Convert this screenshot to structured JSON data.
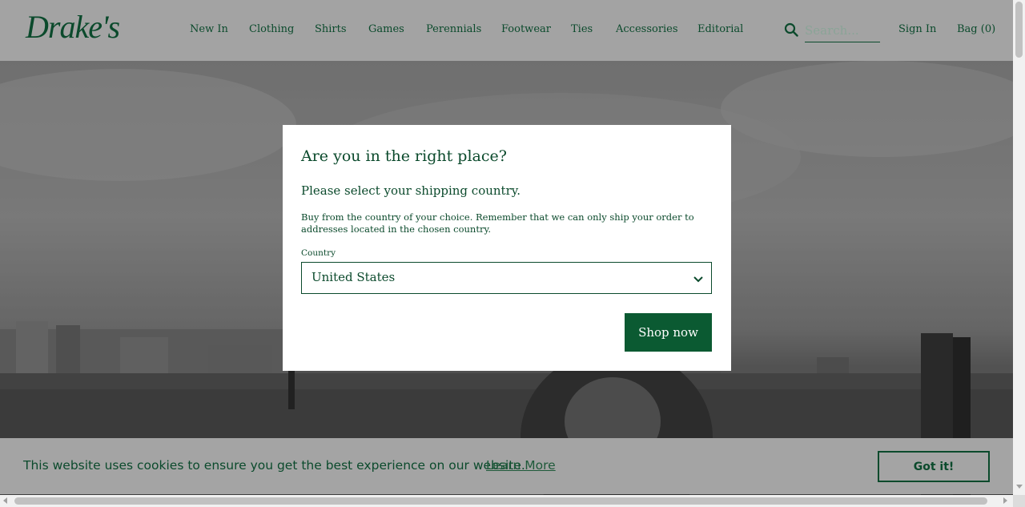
{
  "header": {
    "logo": "Drake's",
    "nav": [
      "New In",
      "Clothing",
      "Shirts",
      "Games",
      "Perennials",
      "Footwear",
      "Ties",
      "Accessories",
      "Editorial"
    ],
    "search_placeholder": "Search...",
    "sign_in": "Sign In",
    "bag": "Bag  (0)"
  },
  "modal": {
    "title": "Are you in the right place?",
    "subtitle": "Please select your shipping country.",
    "text": "Buy from the country of your choice. Remember that we can only ship your order to addresses located in the chosen country.",
    "country_label": "Country",
    "country_value": "United States",
    "button": "Shop now"
  },
  "cookie": {
    "text": "This website uses cookies to ensure you get the best experience on our website.",
    "learn_more": "Learn More",
    "accept": "Got it!"
  },
  "colors": {
    "brand_green": "#0b4a2c",
    "button_green": "#0b5a32"
  }
}
